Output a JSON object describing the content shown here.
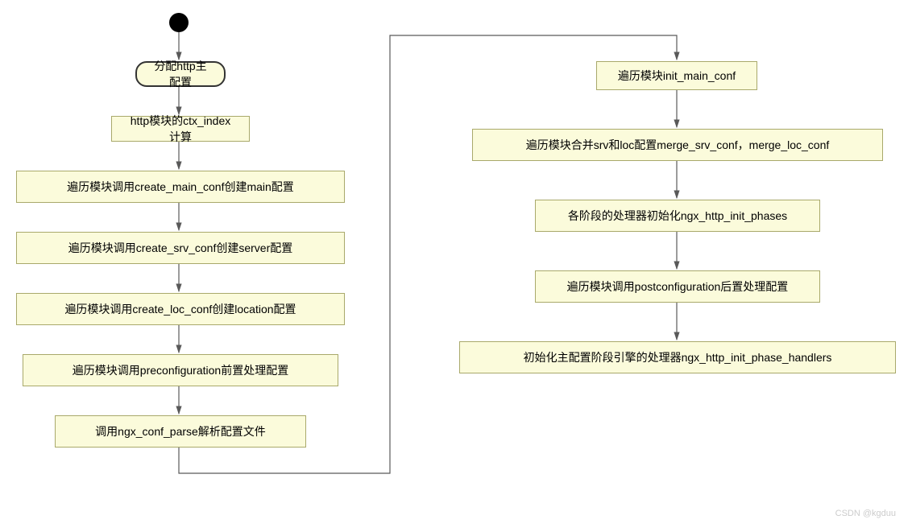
{
  "nodes": {
    "n1": "分配http主配置",
    "n2": "http模块的ctx_index计算",
    "n3": "遍历模块调用create_main_conf创建main配置",
    "n4": "遍历模块调用create_srv_conf创建server配置",
    "n5": "遍历模块调用create_loc_conf创建location配置",
    "n6": "遍历模块调用preconfiguration前置处理配置",
    "n7": "调用ngx_conf_parse解析配置文件",
    "n8": "遍历模块init_main_conf",
    "n9": "遍历模块合并srv和loc配置merge_srv_conf，merge_loc_conf",
    "n10": "各阶段的处理器初始化ngx_http_init_phases",
    "n11": "遍历模块调用postconfiguration后置处理配置",
    "n12": "初始化主配置阶段引擎的处理器ngx_http_init_phase_handlers"
  },
  "watermark": "CSDN @kgduu"
}
